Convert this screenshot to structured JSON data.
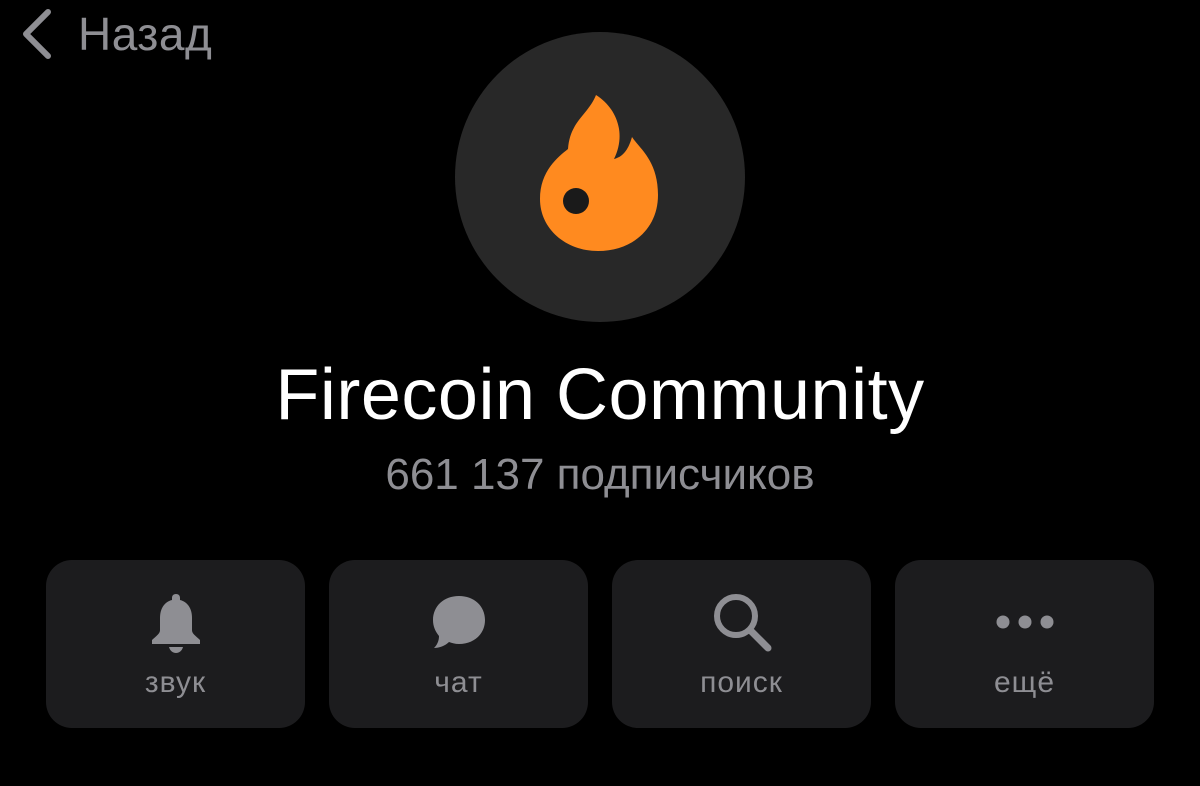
{
  "nav": {
    "back_label": "Назад"
  },
  "channel": {
    "avatar_icon": "fire-icon",
    "title": "Firecoin Community",
    "subscribers_text": "661 137 подписчиков"
  },
  "actions": [
    {
      "label": "звук",
      "icon": "bell-icon"
    },
    {
      "label": "чат",
      "icon": "chat-bubble-icon"
    },
    {
      "label": "поиск",
      "icon": "search-icon"
    },
    {
      "label": "ещё",
      "icon": "more-dots-icon"
    }
  ],
  "colors": {
    "background": "#000000",
    "secondary_text": "#8e8e93",
    "button_background": "#1c1c1e",
    "avatar_background": "#282828",
    "accent": "#ff8a1f"
  }
}
